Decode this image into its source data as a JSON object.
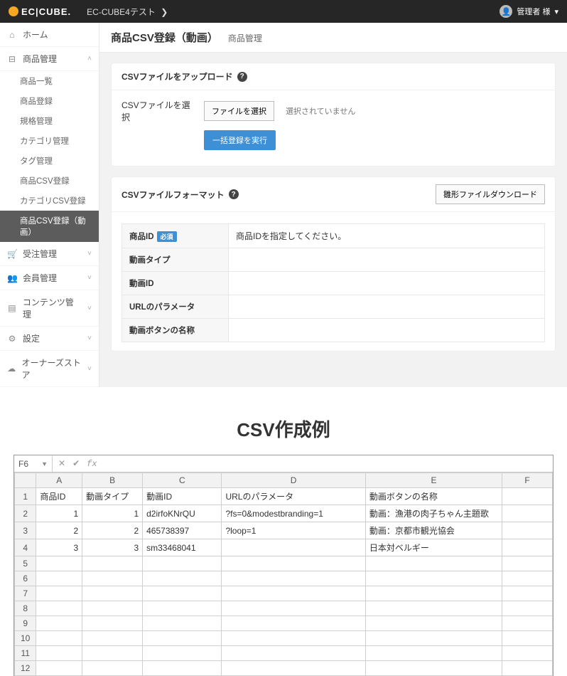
{
  "topbar": {
    "logo_text": "EC|CUBE.",
    "site_name": "EC-CUBE4テスト",
    "chevron": "❯",
    "user_label": "管理者 様",
    "user_chevron": "▾"
  },
  "sidebar": {
    "home": "ホーム",
    "products": "商品管理",
    "sub": {
      "list": "商品一覧",
      "register": "商品登録",
      "class_manage": "規格管理",
      "category": "カテゴリ管理",
      "tag": "タグ管理",
      "csv_product": "商品CSV登録",
      "csv_category": "カテゴリCSV登録",
      "csv_movie": "商品CSV登録（動画）"
    },
    "order": "受注管理",
    "member": "会員管理",
    "content": "コンテンツ管理",
    "setting": "設定",
    "owner": "オーナーズストア"
  },
  "page": {
    "title": "商品CSV登録（動画）",
    "breadcrumb": "商品管理"
  },
  "upload": {
    "panel_title": "CSVファイルをアップロード",
    "field_label": "CSVファイルを選択",
    "file_button": "ファイルを選択",
    "no_file": "選択されていません",
    "exec_button": "一括登録を実行"
  },
  "format": {
    "panel_title": "CSVファイルフォーマット",
    "download_button": "雛形ファイルダウンロード",
    "rows": [
      {
        "label": "商品ID",
        "required": true,
        "desc": "商品IDを指定してください。"
      },
      {
        "label": "動画タイプ",
        "required": false,
        "desc": ""
      },
      {
        "label": "動画ID",
        "required": false,
        "desc": ""
      },
      {
        "label": "URLのパラメータ",
        "required": false,
        "desc": ""
      },
      {
        "label": "動画ボタンの名称",
        "required": false,
        "desc": ""
      }
    ],
    "required_badge": "必須"
  },
  "example": {
    "heading": "CSV作成例",
    "cell_name": "F6",
    "columns": [
      "A",
      "B",
      "C",
      "D",
      "E",
      "F"
    ],
    "headers": [
      "商品ID",
      "動画タイプ",
      "動画ID",
      "URLのパラメータ",
      "動画ボタンの名称"
    ],
    "rows": [
      [
        "1",
        "1",
        "d2irfoKNrQU",
        "?fs=0&modestbranding=1",
        "動画：漁港の肉子ちゃん主題歌"
      ],
      [
        "2",
        "2",
        "465738397",
        "?loop=1",
        "動画：京都市観光協会"
      ],
      [
        "3",
        "3",
        "sm33468041",
        "",
        "日本対ベルギー"
      ]
    ],
    "blank_rows": 8
  },
  "glyph": {
    "help": "?",
    "chev_down": "˅",
    "chev_up": "˄",
    "home": "⌂",
    "box": "⊟",
    "cart": "🛒",
    "users": "👥",
    "doc": "▤",
    "gear": "⚙",
    "cloud": "☁"
  }
}
